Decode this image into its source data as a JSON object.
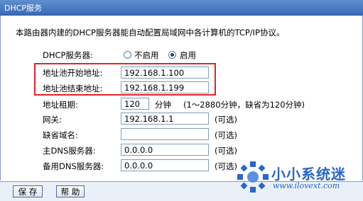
{
  "title": "DHCP服务",
  "description": "本路由器内建的DHCP服务器能自动配置局域网中各计算机的TCP/IP协议。",
  "server": {
    "label": "DHCP服务器:",
    "disable": "不启用",
    "enable": "启用",
    "selected": "enable"
  },
  "fields": {
    "start_label": "地址池开始地址:",
    "start_value": "192.168.1.100",
    "end_label": "地址池结束地址:",
    "end_value": "192.168.1.199",
    "lease_label": "地址租期:",
    "lease_value": "120",
    "lease_unit": "分钟",
    "lease_note": "(1～2880分钟，缺省为120分钟)",
    "gateway_label": "网关:",
    "gateway_value": "192.168.1.1",
    "gateway_note": "(可选)",
    "domain_label": "缺省域名:",
    "domain_value": "",
    "domain_note": "(可选)",
    "dns1_label": "主DNS服务器:",
    "dns1_value": "0.0.0.0",
    "dns1_note": "(可选)",
    "dns2_label": "备用DNS服务器:",
    "dns2_value": "0.0.0.0",
    "dns2_note": "(可选)"
  },
  "buttons": {
    "save": "保 存",
    "help": "帮 助"
  },
  "watermark": {
    "name": "小小系统迷",
    "url": "www.ilovext.com"
  },
  "colors": {
    "title_bar": "#3a6bb5",
    "highlight_box": "#e0242a",
    "watermark": "#2a67c8"
  }
}
